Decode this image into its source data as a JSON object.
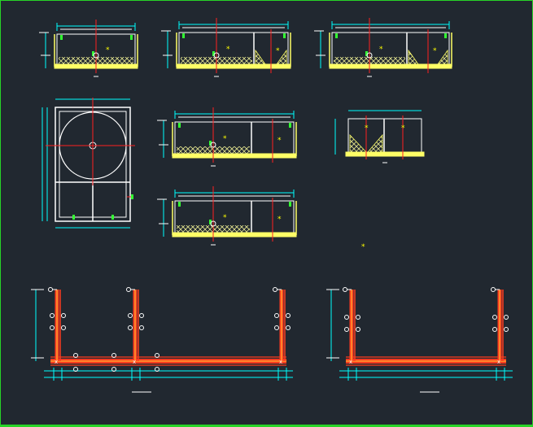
{
  "viewport": {
    "background": "#212830",
    "frame_color": "#27d427"
  },
  "palette": {
    "wall": "#ffffff",
    "slab": "#ffff66",
    "hatch": "#e6e690",
    "dimension": "#00ffff",
    "centerline": "#ff2020",
    "marker": "#33ff33",
    "rebar": "#ff3b1f",
    "rebar_core": "#ffcc33",
    "label_underline": "#ffffff",
    "note_star": "#ffff00"
  },
  "drawing": {
    "section_views": 6,
    "plan_views": 1,
    "reinforcement_details": 2,
    "floating_marker": "*"
  }
}
